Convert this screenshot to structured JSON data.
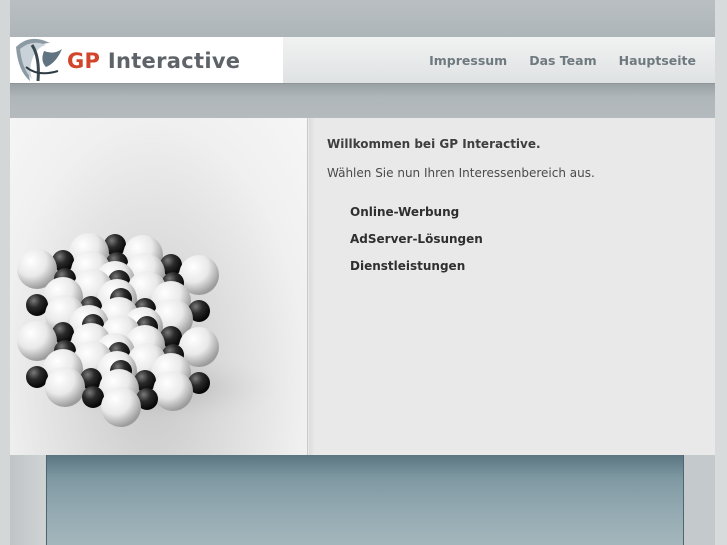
{
  "header": {
    "logo_alt": "GP Interactive logo",
    "brand_gp": "GP",
    "brand_rest": "Interactive"
  },
  "nav": {
    "items": [
      {
        "label": "Impressum"
      },
      {
        "label": "Das Team"
      },
      {
        "label": "Hauptseite"
      }
    ]
  },
  "main": {
    "welcome": "Willkommen bei GP Interactive.",
    "prompt": "Wählen Sie nun Ihren Interessenbereich aus.",
    "links": [
      {
        "label": "Online-Werbung"
      },
      {
        "label": "AdServer-Lösungen"
      },
      {
        "label": "Dienstleistungen"
      }
    ]
  },
  "image": {
    "subject": "molecule-cube"
  },
  "colors": {
    "brand_red": "#d2452a",
    "brand_gray": "#5d6368",
    "nav_text": "#6f7a80",
    "footer_teal": "#7e98a2"
  }
}
